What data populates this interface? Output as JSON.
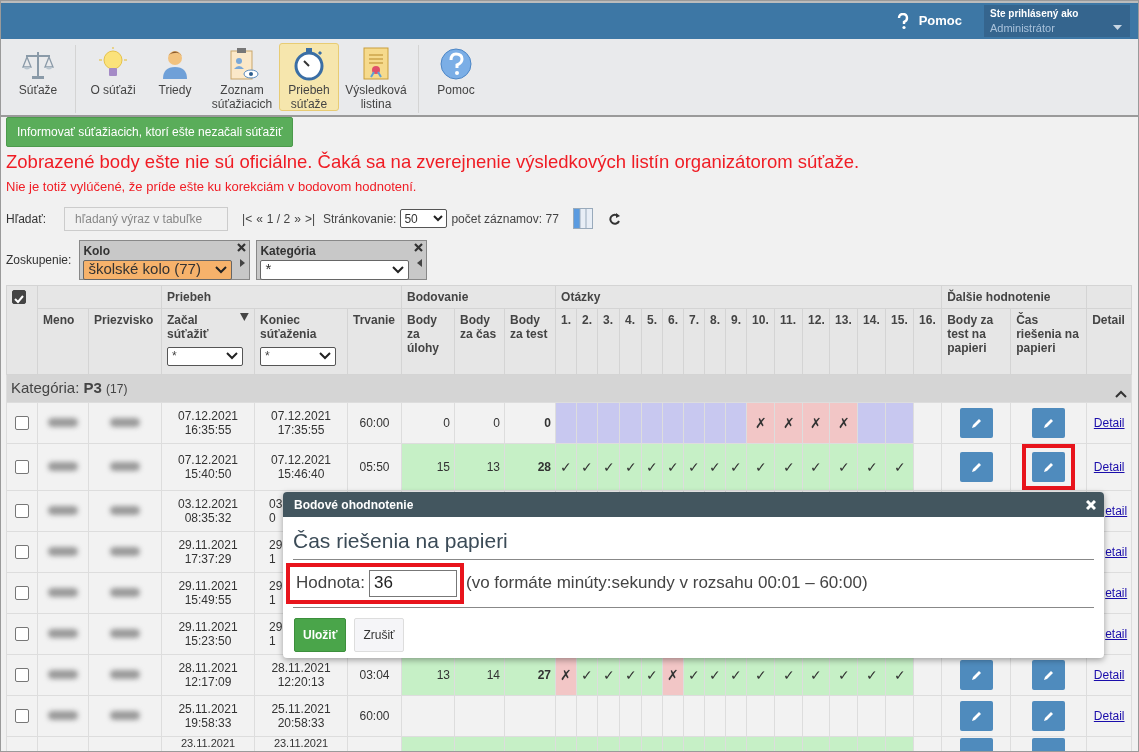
{
  "top_bar": {
    "help": "Pomoc",
    "user_caption": "Ste prihlásený ako",
    "user_name": "Administrátor"
  },
  "toolbar": [
    {
      "kind": "scales",
      "label": "Súťaže",
      "selected": false,
      "separator_after": true
    },
    {
      "kind": "bulb",
      "label": "O súťaži",
      "selected": false,
      "separator_after": false
    },
    {
      "kind": "person",
      "label": "Triedy",
      "selected": false,
      "separator_after": false
    },
    {
      "kind": "clipboard",
      "label": "Zoznam súťažiacich",
      "selected": false,
      "separator_after": false
    },
    {
      "kind": "stopwatch",
      "label": "Priebeh súťaže",
      "selected": true,
      "separator_after": false
    },
    {
      "kind": "certificate",
      "label": "Výsledková listina",
      "selected": false,
      "separator_after": true
    },
    {
      "kind": "help",
      "label": "Pomoc",
      "selected": false,
      "separator_after": false
    }
  ],
  "notify_button": "Informovať súťažiacich, ktorí ešte nezačali súťažiť",
  "warning": "Zobrazené body ešte nie sú oficiálne. Čaká sa na zverejnenie výsledkových listín organizátorom súťaže.",
  "warning_note": "Nie je totiž vylúčené, že príde ešte ku korekciám v bodovom hodnotení.",
  "search": {
    "label": "Hľadať:",
    "placeholder": "hľadaný výraz v tabuľke"
  },
  "pager": {
    "first": "|<",
    "prev": "«",
    "page": "1 / 2",
    "next": "»",
    "last": ">|",
    "page_size_label": "Stránkovanie:",
    "page_size": "50",
    "count": "počet záznamov: 77"
  },
  "grouping": {
    "label": "Zoskupenie:",
    "groups": [
      {
        "title": "Kolo",
        "value": "školské kolo (77)",
        "active": true
      },
      {
        "title": "Kategória",
        "value": "*",
        "active": false
      }
    ]
  },
  "table": {
    "select_all": {
      "checked": true
    },
    "column_groups": [
      {
        "columns": [
          {
            "label": "Meno"
          },
          {
            "label": "Priezvisko"
          }
        ]
      },
      {
        "label": "Priebeh",
        "columns": [
          {
            "label": "Začal súťažiť",
            "sorted": true,
            "filter": "*"
          },
          {
            "label": "Koniec súťaženia",
            "filter": "*"
          },
          {
            "label": "Trvanie"
          }
        ]
      },
      {
        "label": "Bodovanie",
        "columns": [
          {
            "label": "Body za úlohy"
          },
          {
            "label": "Body za čas"
          },
          {
            "label": "Body za test"
          }
        ]
      },
      {
        "label": "Otázky",
        "columns": [
          {
            "label": "1."
          },
          {
            "label": "2."
          },
          {
            "label": "3."
          },
          {
            "label": "4."
          },
          {
            "label": "5."
          },
          {
            "label": "6."
          },
          {
            "label": "7."
          },
          {
            "label": "8."
          },
          {
            "label": "9."
          },
          {
            "label": "10."
          },
          {
            "label": "11."
          },
          {
            "label": "12."
          },
          {
            "label": "13."
          },
          {
            "label": "14."
          },
          {
            "label": "15."
          },
          {
            "label": "16."
          }
        ]
      },
      {
        "label": "Ďalšie hodnotenie",
        "columns": [
          {
            "label": "Body za test na papieri"
          },
          {
            "label": "Čas riešenia na papieri"
          }
        ]
      },
      {
        "columns": [
          {
            "label": "Detail"
          }
        ]
      }
    ],
    "group_row": {
      "text": "Kategória: **P3**",
      "count": "(17)",
      "expanded": true
    },
    "rows": [
      {
        "kind": "full",
        "checked": false,
        "start": [
          "07.12.2021",
          "16:35:55"
        ],
        "end": [
          "07.12.2021",
          "17:35:55"
        ],
        "duration": "60:00",
        "scores": [
          "0",
          "0",
          "0"
        ],
        "scored": false,
        "answers": [
          {
            "kind": "unanswered"
          },
          {
            "kind": "unanswered"
          },
          {
            "kind": "unanswered"
          },
          {
            "kind": "unanswered"
          },
          {
            "kind": "unanswered"
          },
          {
            "kind": "unanswered"
          },
          {
            "kind": "unanswered"
          },
          {
            "kind": "unanswered"
          },
          {
            "kind": "unanswered"
          },
          {
            "kind": "wrong",
            "mark": "✗"
          },
          {
            "kind": "wrong",
            "mark": "✗"
          },
          {
            "kind": "wrong",
            "mark": "✗"
          },
          {
            "kind": "wrong",
            "mark": "✗"
          },
          {
            "kind": "unanswered"
          },
          {
            "kind": "unanswered"
          },
          {
            "kind": "empty"
          }
        ],
        "edit_marked": false,
        "detail": "Detail"
      },
      {
        "kind": "full",
        "checked": false,
        "start": [
          "07.12.2021",
          "15:40:50"
        ],
        "end": [
          "07.12.2021",
          "15:46:40"
        ],
        "duration": "05:50",
        "scores": [
          "15",
          "13",
          "28"
        ],
        "scored": true,
        "answers": [
          {
            "kind": "right",
            "mark": "✓"
          },
          {
            "kind": "right",
            "mark": "✓"
          },
          {
            "kind": "right",
            "mark": "✓"
          },
          {
            "kind": "right",
            "mark": "✓"
          },
          {
            "kind": "right",
            "mark": "✓"
          },
          {
            "kind": "right",
            "mark": "✓"
          },
          {
            "kind": "right",
            "mark": "✓"
          },
          {
            "kind": "right",
            "mark": "✓"
          },
          {
            "kind": "right",
            "mark": "✓"
          },
          {
            "kind": "right",
            "mark": "✓"
          },
          {
            "kind": "right",
            "mark": "✓"
          },
          {
            "kind": "right",
            "mark": "✓"
          },
          {
            "kind": "right",
            "mark": "✓"
          },
          {
            "kind": "right",
            "mark": "✓"
          },
          {
            "kind": "right",
            "mark": "✓"
          },
          {
            "kind": "empty"
          }
        ],
        "edit_marked": true,
        "detail": "Detail"
      },
      {
        "kind": "covered",
        "checked": false,
        "start": [
          "03.12.2021",
          "08:35:32"
        ],
        "end": [
          "03",
          "0"
        ],
        "detail": "etail"
      },
      {
        "kind": "covered",
        "checked": false,
        "start": [
          "29.11.2021",
          "17:37:29"
        ],
        "end": [
          "29",
          "1"
        ],
        "detail": "etail"
      },
      {
        "kind": "covered",
        "checked": false,
        "start": [
          "29.11.2021",
          "15:49:55"
        ],
        "end": [
          "29",
          "1"
        ],
        "detail": "etail"
      },
      {
        "kind": "covered",
        "checked": false,
        "start": [
          "29.11.2021",
          "15:23:50"
        ],
        "end": [
          "29",
          "1"
        ],
        "detail": "etail"
      },
      {
        "kind": "full",
        "checked": false,
        "start": [
          "28.11.2021",
          "12:17:09"
        ],
        "end": [
          "28.11.2021",
          "12:20:13"
        ],
        "duration": "03:04",
        "scores": [
          "13",
          "14",
          "27"
        ],
        "scored": true,
        "answers": [
          {
            "kind": "wrong",
            "mark": "✗"
          },
          {
            "kind": "right",
            "mark": "✓"
          },
          {
            "kind": "right",
            "mark": "✓"
          },
          {
            "kind": "right",
            "mark": "✓"
          },
          {
            "kind": "right",
            "mark": "✓"
          },
          {
            "kind": "wrong",
            "mark": "✗"
          },
          {
            "kind": "right",
            "mark": "✓"
          },
          {
            "kind": "right",
            "mark": "✓"
          },
          {
            "kind": "right",
            "mark": "✓"
          },
          {
            "kind": "right",
            "mark": "✓"
          },
          {
            "kind": "right",
            "mark": "✓"
          },
          {
            "kind": "right",
            "mark": "✓"
          },
          {
            "kind": "right",
            "mark": "✓"
          },
          {
            "kind": "right",
            "mark": "✓"
          },
          {
            "kind": "right",
            "mark": "✓"
          },
          {
            "kind": "empty"
          }
        ],
        "edit_marked": false,
        "detail": "Detail"
      },
      {
        "kind": "full",
        "checked": false,
        "start": [
          "25.11.2021",
          "19:58:33"
        ],
        "end": [
          "25.11.2021",
          "20:58:33"
        ],
        "duration": "60:00",
        "scored": false,
        "answers": [
          {
            "kind": "empty"
          },
          {
            "kind": "empty"
          },
          {
            "kind": "empty"
          },
          {
            "kind": "empty"
          },
          {
            "kind": "empty"
          },
          {
            "kind": "empty"
          },
          {
            "kind": "empty"
          },
          {
            "kind": "empty"
          },
          {
            "kind": "empty"
          },
          {
            "kind": "empty"
          },
          {
            "kind": "empty"
          },
          {
            "kind": "empty"
          },
          {
            "kind": "empty"
          },
          {
            "kind": "empty"
          },
          {
            "kind": "empty"
          },
          {
            "kind": "empty"
          }
        ],
        "edit_marked": false,
        "detail": "Detail"
      },
      {
        "kind": "cut",
        "start": [
          "23.11.2021"
        ],
        "end": [
          "23.11.2021"
        ],
        "scored": true,
        "answers": [
          {
            "kind": "right"
          },
          {
            "kind": "right"
          },
          {
            "kind": "right"
          },
          {
            "kind": "right"
          },
          {
            "kind": "right"
          },
          {
            "kind": "right"
          },
          {
            "kind": "right"
          },
          {
            "kind": "right"
          },
          {
            "kind": "right"
          },
          {
            "kind": "right"
          },
          {
            "kind": "right"
          },
          {
            "kind": "right"
          },
          {
            "kind": "right"
          },
          {
            "kind": "right"
          },
          {
            "kind": "right"
          },
          {
            "kind": "empty"
          }
        ],
        "edit_marked": false
      }
    ]
  },
  "dialog": {
    "title": "Bodové ohodnotenie",
    "heading": "Čas riešenia na papieri",
    "field_label": "Hodnota:",
    "value": "36",
    "field_marked": true,
    "hint": "(vo formáte minúty:sekundy v rozsahu 00:01 – 60:00)",
    "save": "Uložiť",
    "cancel": "Zrušiť"
  }
}
